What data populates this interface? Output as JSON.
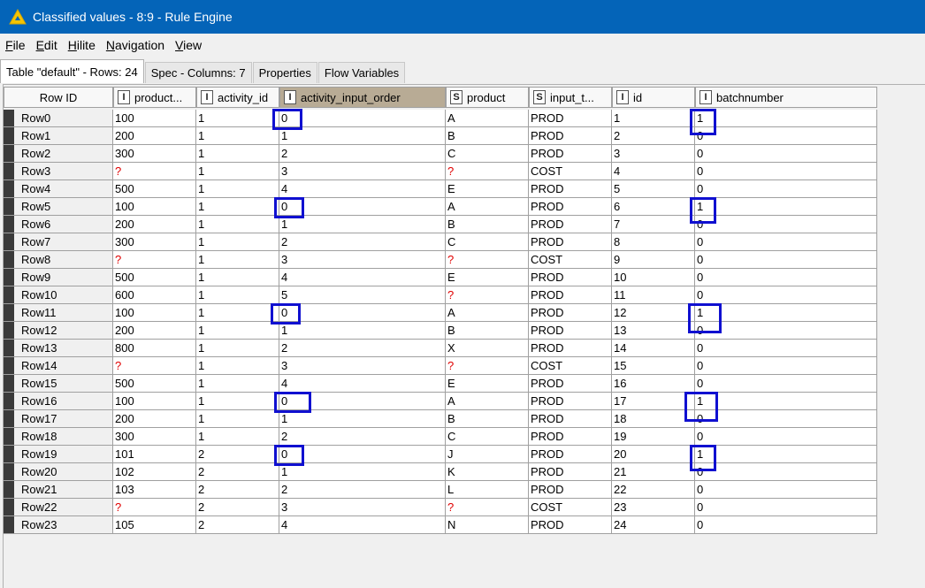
{
  "window": {
    "title": "Classified values - 8:9 - Rule Engine"
  },
  "menu": [
    {
      "key": "F",
      "rest": "ile"
    },
    {
      "key": "E",
      "rest": "dit"
    },
    {
      "key": "H",
      "rest": "ilite"
    },
    {
      "key": "N",
      "rest": "avigation"
    },
    {
      "key": "V",
      "rest": "iew"
    }
  ],
  "tabs": [
    "Table \"default\" - Rows: 24",
    "Spec - Columns: 7",
    "Properties",
    "Flow Variables"
  ],
  "columns": [
    {
      "type": "",
      "name": "Row ID"
    },
    {
      "type": "I",
      "name": "product..."
    },
    {
      "type": "I",
      "name": "activity_id"
    },
    {
      "type": "I",
      "name": "activity_input_order"
    },
    {
      "type": "S",
      "name": "product"
    },
    {
      "type": "S",
      "name": "input_t..."
    },
    {
      "type": "I",
      "name": "id"
    },
    {
      "type": "I",
      "name": "batchnumber"
    }
  ],
  "rows": [
    [
      "Row0",
      "100",
      "1",
      "0",
      "A",
      "PROD",
      "1",
      "1"
    ],
    [
      "Row1",
      "200",
      "1",
      "1",
      "B",
      "PROD",
      "2",
      "0"
    ],
    [
      "Row2",
      "300",
      "1",
      "2",
      "C",
      "PROD",
      "3",
      "0"
    ],
    [
      "Row3",
      "?",
      "1",
      "3",
      "?",
      "COST",
      "4",
      "0"
    ],
    [
      "Row4",
      "500",
      "1",
      "4",
      "E",
      "PROD",
      "5",
      "0"
    ],
    [
      "Row5",
      "100",
      "1",
      "0",
      "A",
      "PROD",
      "6",
      "1"
    ],
    [
      "Row6",
      "200",
      "1",
      "1",
      "B",
      "PROD",
      "7",
      "0"
    ],
    [
      "Row7",
      "300",
      "1",
      "2",
      "C",
      "PROD",
      "8",
      "0"
    ],
    [
      "Row8",
      "?",
      "1",
      "3",
      "?",
      "COST",
      "9",
      "0"
    ],
    [
      "Row9",
      "500",
      "1",
      "4",
      "E",
      "PROD",
      "10",
      "0"
    ],
    [
      "Row10",
      "600",
      "1",
      "5",
      "?",
      "PROD",
      "11",
      "0"
    ],
    [
      "Row11",
      "100",
      "1",
      "0",
      "A",
      "PROD",
      "12",
      "1"
    ],
    [
      "Row12",
      "200",
      "1",
      "1",
      "B",
      "PROD",
      "13",
      "0"
    ],
    [
      "Row13",
      "800",
      "1",
      "2",
      "X",
      "PROD",
      "14",
      "0"
    ],
    [
      "Row14",
      "?",
      "1",
      "3",
      "?",
      "COST",
      "15",
      "0"
    ],
    [
      "Row15",
      "500",
      "1",
      "4",
      "E",
      "PROD",
      "16",
      "0"
    ],
    [
      "Row16",
      "100",
      "1",
      "0",
      "A",
      "PROD",
      "17",
      "1"
    ],
    [
      "Row17",
      "200",
      "1",
      "1",
      "B",
      "PROD",
      "18",
      "0"
    ],
    [
      "Row18",
      "300",
      "1",
      "2",
      "C",
      "PROD",
      "19",
      "0"
    ],
    [
      "Row19",
      "101",
      "2",
      "0",
      "J",
      "PROD",
      "20",
      "1"
    ],
    [
      "Row20",
      "102",
      "2",
      "1",
      "K",
      "PROD",
      "21",
      "0"
    ],
    [
      "Row21",
      "103",
      "2",
      "2",
      "L",
      "PROD",
      "22",
      "0"
    ],
    [
      "Row22",
      "?",
      "2",
      "3",
      "?",
      "COST",
      "23",
      "0"
    ],
    [
      "Row23",
      "105",
      "2",
      "4",
      "N",
      "PROD",
      "24",
      "0"
    ]
  ],
  "highlighted_rows": [
    0,
    5,
    11,
    16,
    19
  ],
  "colors": {
    "titlebar": "#0464b8",
    "missing": "#e00000",
    "highlight_box": "#1010d0",
    "sorted_header": "#b8ab95"
  }
}
